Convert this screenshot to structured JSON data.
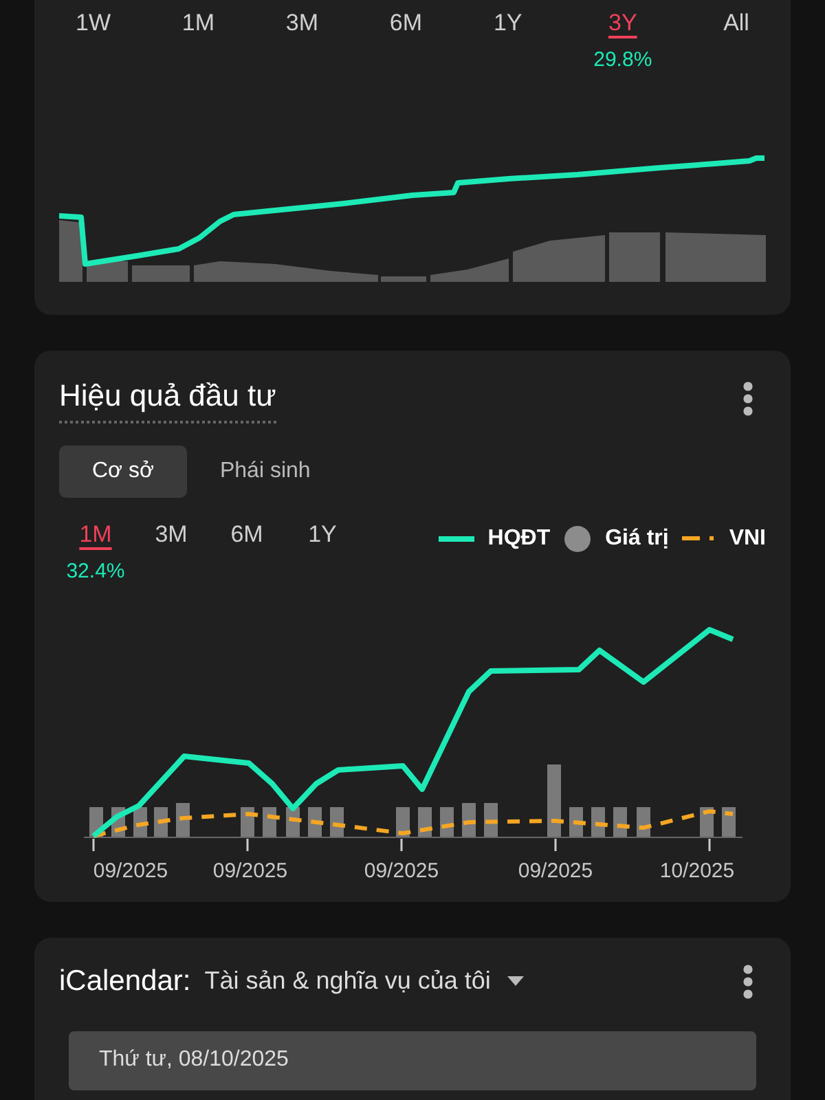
{
  "performance_card": {
    "ranges": [
      {
        "label": "1W",
        "selected": false
      },
      {
        "label": "1M",
        "selected": false
      },
      {
        "label": "3M",
        "selected": false
      },
      {
        "label": "6M",
        "selected": false
      },
      {
        "label": "1Y",
        "selected": false
      },
      {
        "label": "3Y",
        "selected": true,
        "return": "29.8%"
      },
      {
        "label": "All",
        "selected": false
      }
    ]
  },
  "investment_card": {
    "title": "Hiệu quả đầu tư",
    "tabs": [
      {
        "label": "Cơ sở",
        "selected": true
      },
      {
        "label": "Phái sinh",
        "selected": false
      }
    ],
    "ranges": [
      {
        "label": "1M",
        "selected": true,
        "return": "32.4%"
      },
      {
        "label": "3M",
        "selected": false
      },
      {
        "label": "6M",
        "selected": false
      },
      {
        "label": "1Y",
        "selected": false
      }
    ],
    "legend": [
      {
        "kind": "line",
        "label": "HQĐT",
        "color": "#1de9b6"
      },
      {
        "kind": "dot",
        "label": "Giá trị",
        "color": "#8c8c8c"
      },
      {
        "kind": "dashed",
        "label": "VNI",
        "color": "#f5a623"
      }
    ],
    "x_labels": [
      "09/2025",
      "09/2025",
      "09/2025",
      "09/2025",
      "10/2025"
    ]
  },
  "calendar_card": {
    "title": "iCalendar:",
    "filter": "Tài sản & nghĩa vụ của tôi",
    "date": "Thứ tư, 08/10/2025"
  }
}
